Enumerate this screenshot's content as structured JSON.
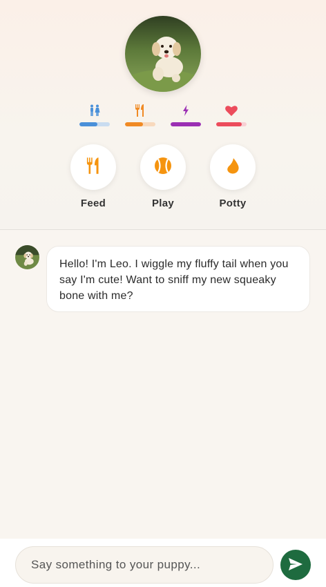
{
  "pet": {
    "name": "Leo",
    "avatar_icon": "puppy-photo"
  },
  "stats": [
    {
      "name": "potty",
      "icon": "restroom-icon",
      "color": "#4a90d9",
      "track": "#c9dcf0",
      "level": 0.6
    },
    {
      "name": "hunger",
      "icon": "utensils-icon",
      "color": "#f08a24",
      "track": "#f8d9bd",
      "level": 0.6
    },
    {
      "name": "energy",
      "icon": "lightning-icon",
      "color": "#9b2fb3",
      "track": "#e4c8ec",
      "level": 1.0
    },
    {
      "name": "love",
      "icon": "heart-icon",
      "color": "#ec4c5c",
      "track": "#f8d0d4",
      "level": 0.85
    }
  ],
  "actions": [
    {
      "label": "Feed",
      "icon": "utensils-icon",
      "color": "#f5940f"
    },
    {
      "label": "Play",
      "icon": "ball-icon",
      "color": "#f5940f"
    },
    {
      "label": "Potty",
      "icon": "water-drop-icon",
      "color": "#f5940f"
    }
  ],
  "chat": {
    "messages": [
      {
        "sender": "pet",
        "text": "Hello! I'm Leo. I wiggle my fluffy tail when you say I'm cute! Want to sniff my new squeaky bone with me?"
      }
    ]
  },
  "composer": {
    "placeholder": "Say something to your puppy...",
    "value": "",
    "send_icon": "send-icon",
    "send_color": "#1e6b3f"
  }
}
